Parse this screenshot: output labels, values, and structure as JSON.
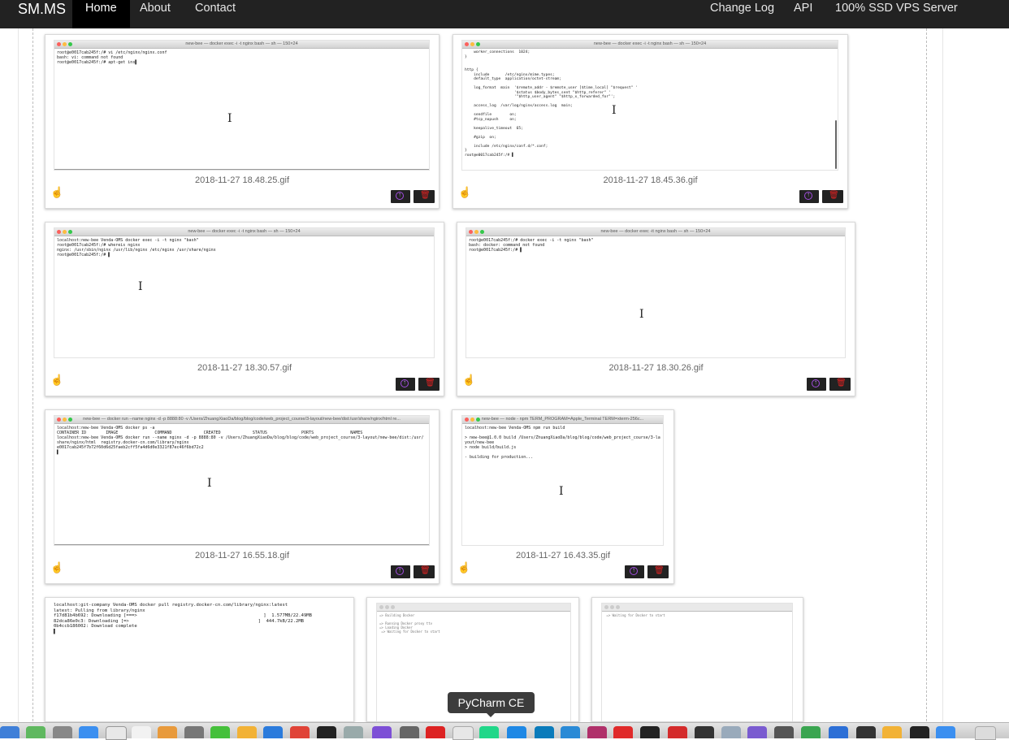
{
  "navbar": {
    "brand": "SM.MS",
    "left_items": [
      "Home",
      "About",
      "Contact"
    ],
    "right_items": [
      "Change Log",
      "API",
      "100% SSD VPS Server"
    ],
    "active": "Home"
  },
  "cards": [
    {
      "filename": "2018-11-27 18.48.25.gif",
      "window_title": "new-bee — docker exec -i -t nginx bash — sh — 150×24",
      "terminal": "root@e0017cab245f:/# vi /etc/nginx/nginx.conf\nbash: vi: command not found\nroot@e0017cab245f:/# apt-get ins▌"
    },
    {
      "filename": "2018-11-27 18.45.36.gif",
      "window_title": "new-bee — docker exec -i -t nginx bash — sh — 150×24",
      "terminal": "    worker_connections  1024;\n}\n\n\nhttp {\n    include       /etc/nginx/mime.types;\n    default_type  application/octet-stream;\n\n    log_format  main  '$remote_addr - $remote_user [$time_local] \"$request\" '\n                      '$status $body_bytes_sent \"$http_referer\" '\n                      '\"$http_user_agent\" \"$http_x_forwarded_for\"';\n\n    access_log  /var/log/nginx/access.log  main;\n\n    sendfile        on;\n    #tcp_nopush     on;\n\n    keepalive_timeout  65;\n\n    #gzip  on;\n\n    include /etc/nginx/conf.d/*.conf;\n}\nroot@e0017cab245f:/# ▌"
    },
    {
      "filename": "2018-11-27 18.30.57.gif",
      "window_title": "new-bee — docker exec -i -t nginx bash — sh — 150×24",
      "terminal": "localhost:new-bee Venda-OMS docker exec -i -t nginx \"bash\"\nroot@e0017cab245f:/# whereis nginx\nnginx: /usr/sbin/nginx /usr/lib/nginx /etc/nginx /usr/share/nginx\nroot@e0017cab245f:/# ▌"
    },
    {
      "filename": "2018-11-27 18.30.26.gif",
      "window_title": "new-bee — docker exec -it nginx bash — sh — 150×24",
      "terminal": "root@e0017cab245f:/# docker exec -i -t nginx \"bash\"\nbash: docker: command not found\nroot@e0017cab245f:/# ▌"
    },
    {
      "filename": "2018-11-27 16.55.18.gif",
      "window_title": "new-bee — docker run --name nginx -d -p 8888:80 -v /Users/ZhuangXiaoDa/blog/blog/code/web_project_course/3-layout/new-bee/dist:/usr/share/nginx/html re...",
      "terminal": "localhost:new-bee Venda-OMS docker ps -a\nCONTAINER ID        IMAGE               COMMAND             CREATED             STATUS              PORTS               NAMES\nlocalhost:new-bee Venda-OMS docker run --name nginx -d -p 8888:80 -v /Users/ZhuangXiaoDa/blog/blog/code/web_project_course/3-layout/new-bee/dist:/usr/\nshare/nginx/html  registry.docker-cn.com/library/nginx\ne0017cab245f7b72f60d6d25faeb2cff5fa4d6d0e3321f87ec46f6bd72c2\n▌"
    },
    {
      "filename": "2018-11-27 16.43.35.gif",
      "window_title": "new-bee — node - npm TERM_PROGRAM=Apple_Terminal TERM=xterm-256c...",
      "terminal": "localhost:new-bee Venda-OMS npm run build\n\n> new-bee@1.0.0 build /Users/ZhuangXiaoDa/blog/blog/code/web_project_course/3-la\nyout/new-bee\n> node build/build.js\n\n- building for production..."
    }
  ],
  "partial_cards": [
    {
      "terminal": "localhost:git-company Venda-OMS docker pull registry.docker-cn.com/library/nginx:latest\nlatest: Pulling from library/nginx\nf17d81b4b692: Downloading [===>                                               ]  1.577MB/22.49MB\n82dca86e0c3: Downloading [=>                                                ]  444.7kB/22.2MB\n0b4ccb186002: Download complete\n▌"
    },
    {
      "terminal": "=> Building Docker\n\n=> Running Docker proxy ttv\n=> Loading Docker\n => Waiting for Docker to start"
    },
    {
      "terminal": " => Waiting for Docker to start\n\n\n\n\n\n\n\n\n\n\n\n\n\n\n\n\n\n\n\n\n\n\n\n\n\n\n=> Done.\n=> Loading local images"
    }
  ],
  "tooltip": "PyCharm CE",
  "actions": {
    "upload_icon": "upload-circle-icon",
    "delete_icon": "trash-icon",
    "share_icon": "hand-pointer-icon"
  }
}
